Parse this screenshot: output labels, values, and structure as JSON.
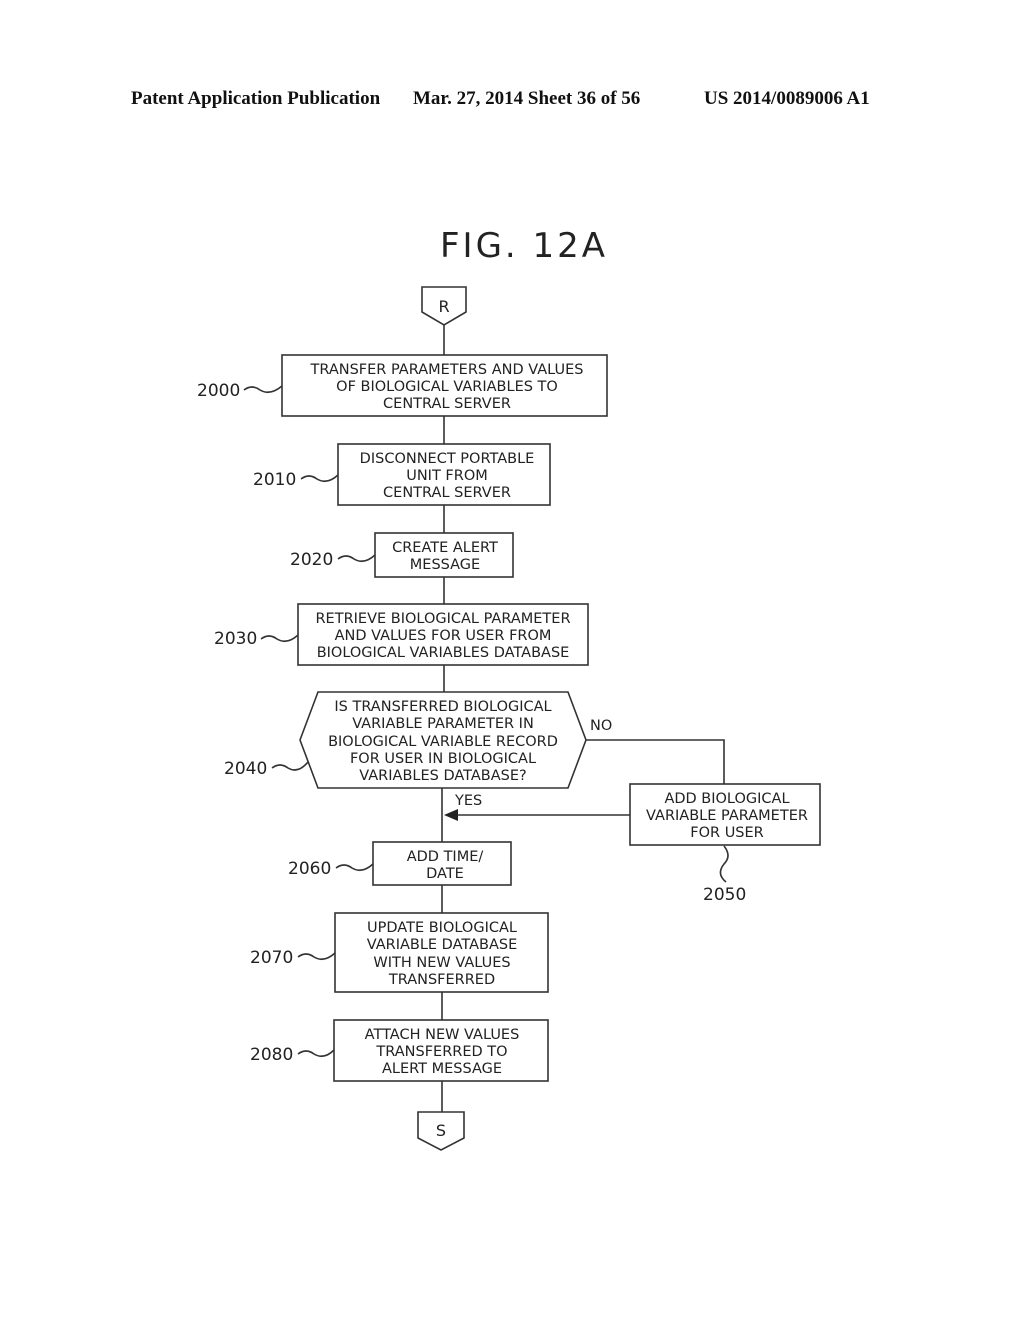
{
  "header": {
    "publication": "Patent Application Publication",
    "date_sheet": "Mar. 27, 2014  Sheet 36 of 56",
    "number": "US 2014/0089006 A1"
  },
  "figure": {
    "title": "FIG. 12A",
    "connectors": {
      "start": "R",
      "end": "S"
    },
    "steps": [
      {
        "ref": "2000",
        "lines": [
          "TRANSFER PARAMETERS AND VALUES",
          "OF BIOLOGICAL VARIABLES TO",
          "CENTRAL SERVER"
        ]
      },
      {
        "ref": "2010",
        "lines": [
          "DISCONNECT PORTABLE",
          "UNIT FROM",
          "CENTRAL SERVER"
        ]
      },
      {
        "ref": "2020",
        "lines": [
          "CREATE ALERT",
          "MESSAGE"
        ]
      },
      {
        "ref": "2030",
        "lines": [
          "RETRIEVE BIOLOGICAL PARAMETER",
          "AND VALUES FOR USER FROM",
          "BIOLOGICAL VARIABLES DATABASE"
        ]
      },
      {
        "ref": "2040",
        "lines": [
          "IS TRANSFERRED BIOLOGICAL",
          "VARIABLE PARAMETER IN",
          "BIOLOGICAL VARIABLE RECORD",
          "FOR USER IN BIOLOGICAL",
          "VARIABLES DATABASE?"
        ]
      },
      {
        "ref": "2050",
        "lines": [
          "ADD BIOLOGICAL",
          "VARIABLE PARAMETER",
          "FOR USER"
        ]
      },
      {
        "ref": "2060",
        "lines": [
          "ADD TIME/",
          "DATE"
        ]
      },
      {
        "ref": "2070",
        "lines": [
          "UPDATE BIOLOGICAL",
          "VARIABLE DATABASE",
          "WITH NEW VALUES",
          "TRANSFERRED"
        ]
      },
      {
        "ref": "2080",
        "lines": [
          "ATTACH NEW VALUES",
          "TRANSFERRED TO",
          "ALERT MESSAGE"
        ]
      }
    ],
    "branch_labels": {
      "yes": "YES",
      "no": "NO"
    }
  }
}
